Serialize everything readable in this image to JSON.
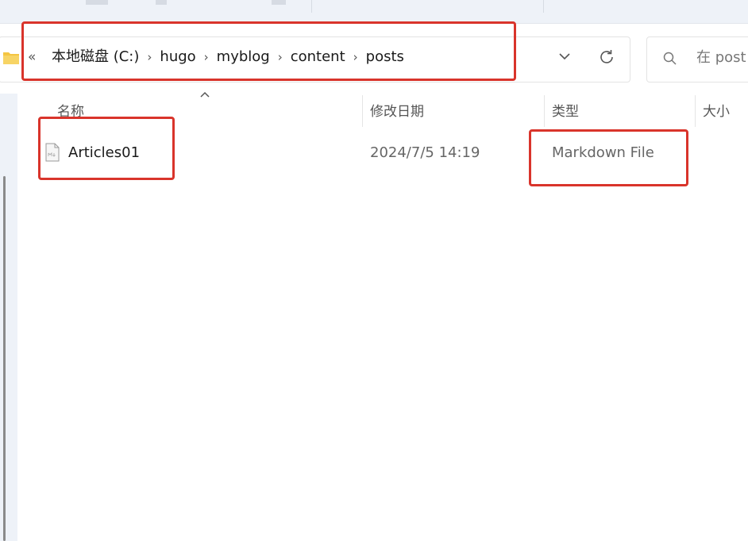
{
  "breadcrumb": {
    "back_glyph": "«",
    "segments": [
      "本地磁盘 (C:)",
      "hugo",
      "myblog",
      "content",
      "posts"
    ]
  },
  "search": {
    "placeholder": "在 post"
  },
  "columns": {
    "name": "名称",
    "date": "修改日期",
    "type": "类型",
    "size": "大小"
  },
  "files": [
    {
      "name": "Articles01",
      "modified": "2024/7/5 14:19",
      "type": "Markdown File",
      "icon": "markdown-file-icon"
    }
  ],
  "icons": {
    "folder": "folder-icon",
    "dropdown": "chevron-down-icon",
    "refresh": "refresh-icon",
    "search": "search-icon",
    "sort": "sort-ascending-icon"
  },
  "colors": {
    "highlight": "#d9342b",
    "folder": "#f4c542"
  }
}
